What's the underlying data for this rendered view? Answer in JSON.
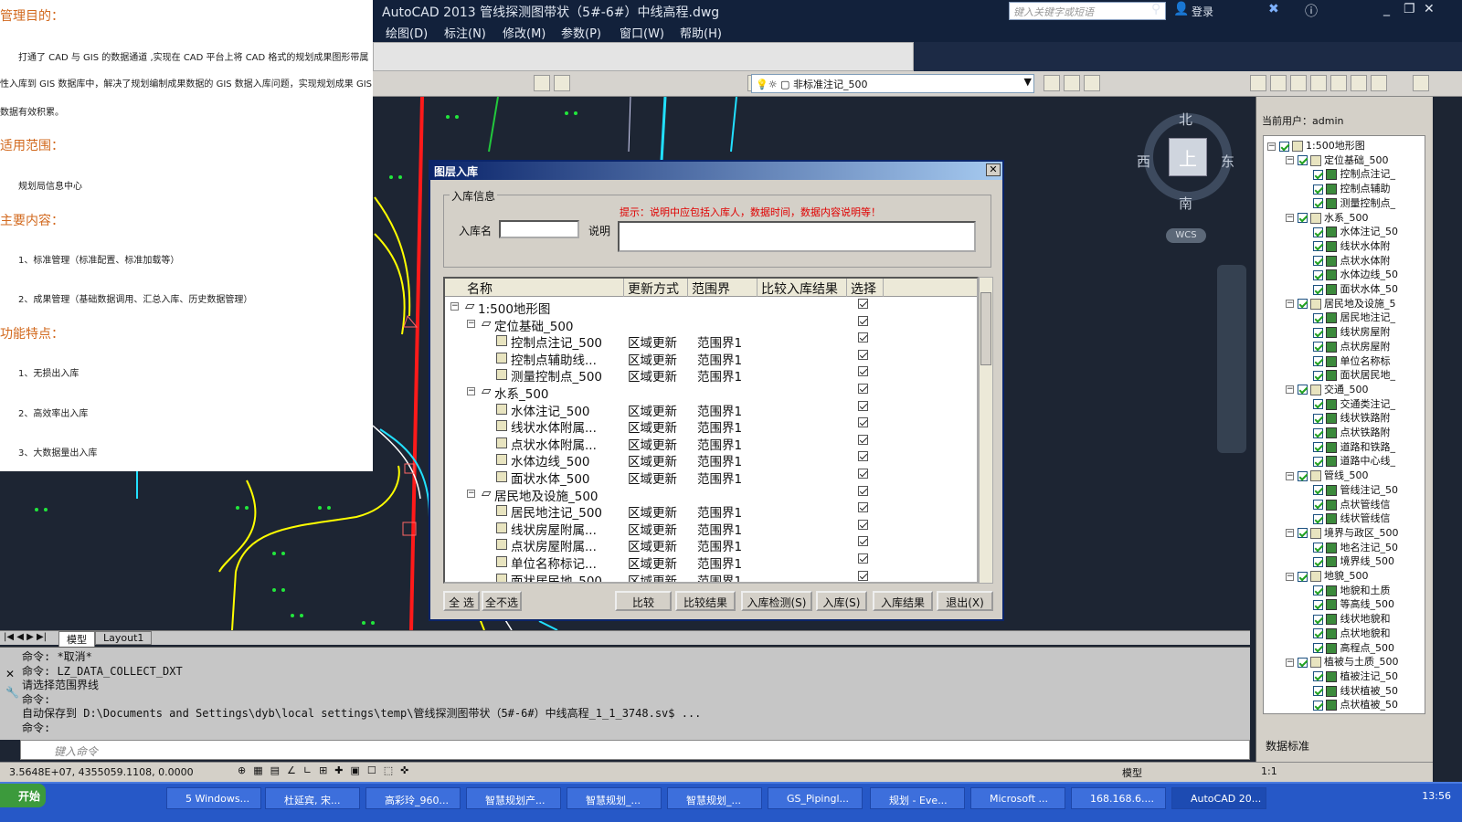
{
  "doc": {
    "h1": "管理目的：",
    "p1": "打通了 CAD 与 GIS 的数据通道 ,实现在 CAD 平台上将 CAD 格式的规划成果图形带属",
    "p2": "性入库到 GIS 数据库中，解决了规划编制成果数据的 GIS 数据入库问题，实现规划成果 GIS",
    "p3": "数据有效积累。",
    "h2": "适用范围：",
    "p4": "规划局信息中心",
    "h3": "主要内容：",
    "p5": "1、标准管理（标准配置、标准加载等）",
    "p6": "2、成果管理（基础数据调用、汇总入库、历史数据管理）",
    "h4": "功能特点：",
    "p7": "1、无损出入库",
    "p8": "2、高效率出入库",
    "p9": "3、大数据量出入库"
  },
  "title": "AutoCAD 2013    管线探测图带状（5#-6#）中线高程.dwg",
  "search_placeholder": "键入关键字或短语",
  "login": "登录",
  "menu": [
    "绘图(D)",
    "标注(N)",
    "修改(M)",
    "参数(P)",
    "窗口(W)",
    "帮助(H)"
  ],
  "layer_name": "非标准注记_500",
  "compass": {
    "n": "北",
    "s": "南",
    "e": "东",
    "w": "西",
    "center": "上",
    "wcs": "WCS"
  },
  "tabs": [
    "模型",
    "Layout1"
  ],
  "command_lines": [
    "命令: *取消*",
    "命令: LZ_DATA_COLLECT_DXT",
    "请选择范围界线",
    "命令:",
    "自动保存到 D:\\Documents and Settings\\dyb\\local settings\\temp\\管线探测图带状（5#-6#）中线高程_1_1_3748.sv$ ...",
    "命令:"
  ],
  "command_placeholder": "键入命令",
  "status": {
    "coords": "3.5648E+07,  4355059.1108,  0.0000",
    "model": "模型",
    "scale": "1:1"
  },
  "right_panel": {
    "user": "当前用户：admin",
    "footer": "数据标准",
    "tree": [
      {
        "level": 0,
        "label": "1:500地形图"
      },
      {
        "level": 1,
        "label": "定位基础_500"
      },
      {
        "level": 2,
        "label": "控制点注记_"
      },
      {
        "level": 2,
        "label": "控制点辅助"
      },
      {
        "level": 2,
        "label": "测量控制点_"
      },
      {
        "level": 1,
        "label": "水系_500"
      },
      {
        "level": 2,
        "label": "水体注记_50"
      },
      {
        "level": 2,
        "label": "线状水体附"
      },
      {
        "level": 2,
        "label": "点状水体附"
      },
      {
        "level": 2,
        "label": "水体边线_50"
      },
      {
        "level": 2,
        "label": "面状水体_50"
      },
      {
        "level": 1,
        "label": "居民地及设施_5"
      },
      {
        "level": 2,
        "label": "居民地注记_"
      },
      {
        "level": 2,
        "label": "线状房屋附"
      },
      {
        "level": 2,
        "label": "点状房屋附"
      },
      {
        "level": 2,
        "label": "单位名称标"
      },
      {
        "level": 2,
        "label": "面状居民地_"
      },
      {
        "level": 1,
        "label": "交通_500"
      },
      {
        "level": 2,
        "label": "交通类注记_"
      },
      {
        "level": 2,
        "label": "线状铁路附"
      },
      {
        "level": 2,
        "label": "点状铁路附"
      },
      {
        "level": 2,
        "label": "道路和铁路_"
      },
      {
        "level": 2,
        "label": "道路中心线_"
      },
      {
        "level": 1,
        "label": "管线_500"
      },
      {
        "level": 2,
        "label": "管线注记_50"
      },
      {
        "level": 2,
        "label": "点状管线信"
      },
      {
        "level": 2,
        "label": "线状管线信"
      },
      {
        "level": 1,
        "label": "境界与政区_500"
      },
      {
        "level": 2,
        "label": "地名注记_50"
      },
      {
        "level": 2,
        "label": "境界线_500"
      },
      {
        "level": 1,
        "label": "地貌_500"
      },
      {
        "level": 2,
        "label": "地貌和土质"
      },
      {
        "level": 2,
        "label": "等高线_500"
      },
      {
        "level": 2,
        "label": "线状地貌和"
      },
      {
        "level": 2,
        "label": "点状地貌和"
      },
      {
        "level": 2,
        "label": "高程点_500"
      },
      {
        "level": 1,
        "label": "植被与土质_500"
      },
      {
        "level": 2,
        "label": "植被注记_50"
      },
      {
        "level": 2,
        "label": "线状植被_50"
      },
      {
        "level": 2,
        "label": "点状植被_50"
      }
    ]
  },
  "dialog": {
    "title": "图层入库",
    "group": "入库信息",
    "name_label": "入库名",
    "desc_label": "说明",
    "hint": "提示：说明中应包括入库人，数据时间，数据内容说明等！",
    "columns": [
      "名称",
      "更新方式",
      "范围界",
      "比较入库结果",
      "选择"
    ],
    "rows": [
      {
        "level": 0,
        "name": "1:500地形图",
        "mode": "",
        "range": ""
      },
      {
        "level": 1,
        "name": "定位基础_500",
        "mode": "",
        "range": ""
      },
      {
        "level": 2,
        "name": "控制点注记_500",
        "mode": "区域更新",
        "range": "范围界1"
      },
      {
        "level": 2,
        "name": "控制点辅助线...",
        "mode": "区域更新",
        "range": "范围界1"
      },
      {
        "level": 2,
        "name": "测量控制点_500",
        "mode": "区域更新",
        "range": "范围界1"
      },
      {
        "level": 1,
        "name": "水系_500",
        "mode": "",
        "range": ""
      },
      {
        "level": 2,
        "name": "水体注记_500",
        "mode": "区域更新",
        "range": "范围界1"
      },
      {
        "level": 2,
        "name": "线状水体附属...",
        "mode": "区域更新",
        "range": "范围界1"
      },
      {
        "level": 2,
        "name": "点状水体附属...",
        "mode": "区域更新",
        "range": "范围界1"
      },
      {
        "level": 2,
        "name": "水体边线_500",
        "mode": "区域更新",
        "range": "范围界1"
      },
      {
        "level": 2,
        "name": "面状水体_500",
        "mode": "区域更新",
        "range": "范围界1"
      },
      {
        "level": 1,
        "name": "居民地及设施_500",
        "mode": "",
        "range": ""
      },
      {
        "level": 2,
        "name": "居民地注记_500",
        "mode": "区域更新",
        "range": "范围界1"
      },
      {
        "level": 2,
        "name": "线状房屋附属...",
        "mode": "区域更新",
        "range": "范围界1"
      },
      {
        "level": 2,
        "name": "点状房屋附属...",
        "mode": "区域更新",
        "range": "范围界1"
      },
      {
        "level": 2,
        "name": "单位名称标记...",
        "mode": "区域更新",
        "range": "范围界1"
      },
      {
        "level": 2,
        "name": "面状居民地_500",
        "mode": "区域更新",
        "range": "范围界1"
      }
    ],
    "buttons": {
      "select_all": "全 选",
      "select_none": "全不选",
      "compare": "比较",
      "compare_result": "比较结果",
      "check": "入库检测(S)",
      "import": "入库(S)",
      "import_result": "入库结果",
      "exit": "退出(X)"
    }
  },
  "taskbar": {
    "start": "开始",
    "items": [
      "5 Windows...",
      "杜延宾, 宋...",
      "高彩玲_960...",
      "智慧规划产...",
      "智慧规划_...",
      "智慧规划_...",
      "GS_Pipingl...",
      "规划 - Eve...",
      "Microsoft ...",
      "168.168.6....",
      "AutoCAD 20..."
    ],
    "clock": "13:56"
  }
}
